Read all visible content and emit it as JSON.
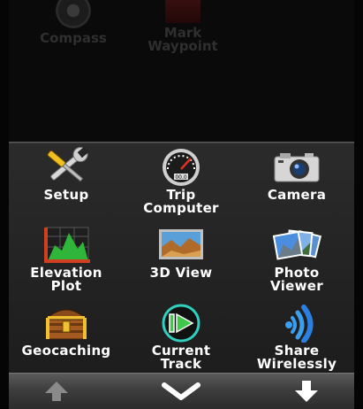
{
  "background_apps": [
    {
      "label": "Compass",
      "icon": "compass-icon"
    },
    {
      "label": "Mark\nWaypoint",
      "icon": "flag-icon"
    }
  ],
  "drawer": {
    "items": [
      {
        "label": "Setup",
        "icon": "wrench-screwdriver-icon"
      },
      {
        "label": "Trip\nComputer",
        "icon": "speedometer-icon"
      },
      {
        "label": "Camera",
        "icon": "camera-icon"
      },
      {
        "label": "Elevation\nPlot",
        "icon": "elevation-chart-icon"
      },
      {
        "label": "3D View",
        "icon": "terrain-3d-icon"
      },
      {
        "label": "Photo\nViewer",
        "icon": "photos-icon"
      },
      {
        "label": "Geocaching",
        "icon": "treasure-chest-icon"
      },
      {
        "label": "Current\nTrack",
        "icon": "play-track-icon"
      },
      {
        "label": "Share\nWirelessly",
        "icon": "wireless-share-icon"
      }
    ]
  },
  "nav": {
    "buttons": [
      {
        "name": "scroll-up",
        "icon": "arrow-up-icon",
        "enabled": false
      },
      {
        "name": "collapse",
        "icon": "chevron-down-icon",
        "enabled": true
      },
      {
        "name": "scroll-down",
        "icon": "arrow-down-icon",
        "enabled": true
      }
    ]
  },
  "colors": {
    "drawer_bg": "#262626",
    "label": "#ffffff",
    "nav_bg": "#4a4a4a",
    "disabled_arrow": "#8a8a8a"
  }
}
